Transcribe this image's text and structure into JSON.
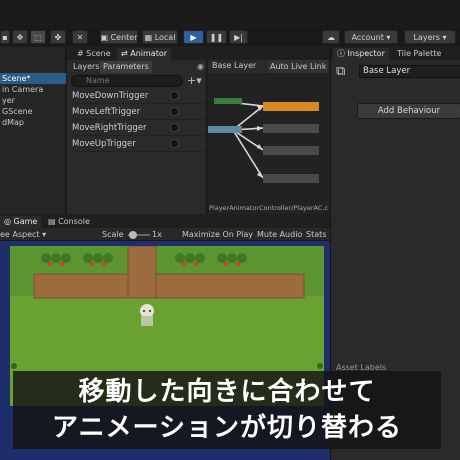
{
  "toolbar": {
    "center_label": "Center",
    "local_label": "Local",
    "account_label": "Account",
    "layers_label": "Layers"
  },
  "hierarchy": {
    "items": [
      "Scene*",
      "in Camera",
      "yer",
      "GScene",
      "dMap"
    ]
  },
  "scene_tabs": {
    "scene": "Scene",
    "animator": "Animator"
  },
  "animator": {
    "layers_tab": "Layers",
    "parameters_tab": "Parameters",
    "search_placeholder": "Name",
    "base_layer": "Base Layer",
    "auto_live_link": "Auto Live Link",
    "parameters": [
      "MoveDownTrigger",
      "MoveLeftTrigger",
      "MoveRightTrigger",
      "MoveUpTrigger"
    ],
    "path": "PlayerAnimatorController/PlayerAC.c"
  },
  "inspector": {
    "tab_inspector": "Inspector",
    "tab_tile_palette": "Tile Palette",
    "layer_name": "Base Layer",
    "add_behaviour": "Add Behaviour",
    "asset_labels": "Asset Labels"
  },
  "game": {
    "tab_game": "Game",
    "tab_console": "Console",
    "aspect": "ee Aspect",
    "scale_label": "Scale",
    "scale_value": "1x",
    "maximize": "Maximize On Play",
    "mute": "Mute Audio",
    "stats": "Stats"
  },
  "caption": {
    "line1": "移動した向きに合わせて",
    "line2": "アニメーションが切り替わる"
  },
  "colors": {
    "accent_blue": "#2f5f9e",
    "selection": "#2c5d87",
    "orange_state": "#d98a1f",
    "green_state": "#3a7d3a",
    "grass": "#6aa232",
    "water": "#1e2e6b"
  }
}
